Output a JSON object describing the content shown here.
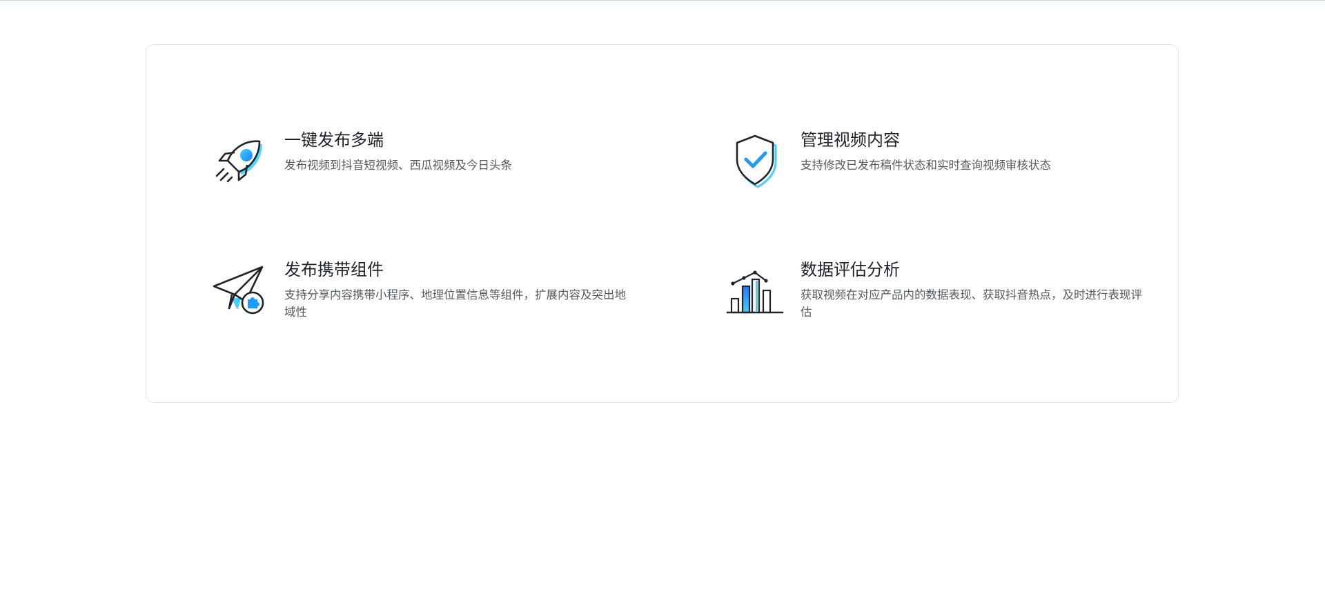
{
  "features": [
    {
      "icon": "rocket-icon",
      "title": "一键发布多端",
      "description": "发布视频到抖音短视频、西瓜视频及今日头条"
    },
    {
      "icon": "shield-check-icon",
      "title": "管理视频内容",
      "description": "支持修改已发布稿件状态和实时查询视频审核状态"
    },
    {
      "icon": "paper-plane-puzzle-icon",
      "title": "发布携带组件",
      "description": "支持分享内容携带小程序、地理位置信息等组件，扩展内容及突出地域性"
    },
    {
      "icon": "bar-chart-icon",
      "title": "数据评估分析",
      "description": "获取视频在对应产品内的数据表现、获取抖音热点，及时进行表现评估"
    }
  ],
  "colors": {
    "accent": "#1e9bff",
    "accent_light": "#3fd0ff",
    "stroke": "#1f2329",
    "title": "#1f2329",
    "description": "#555a61",
    "card_border": "#e3e5e8"
  }
}
